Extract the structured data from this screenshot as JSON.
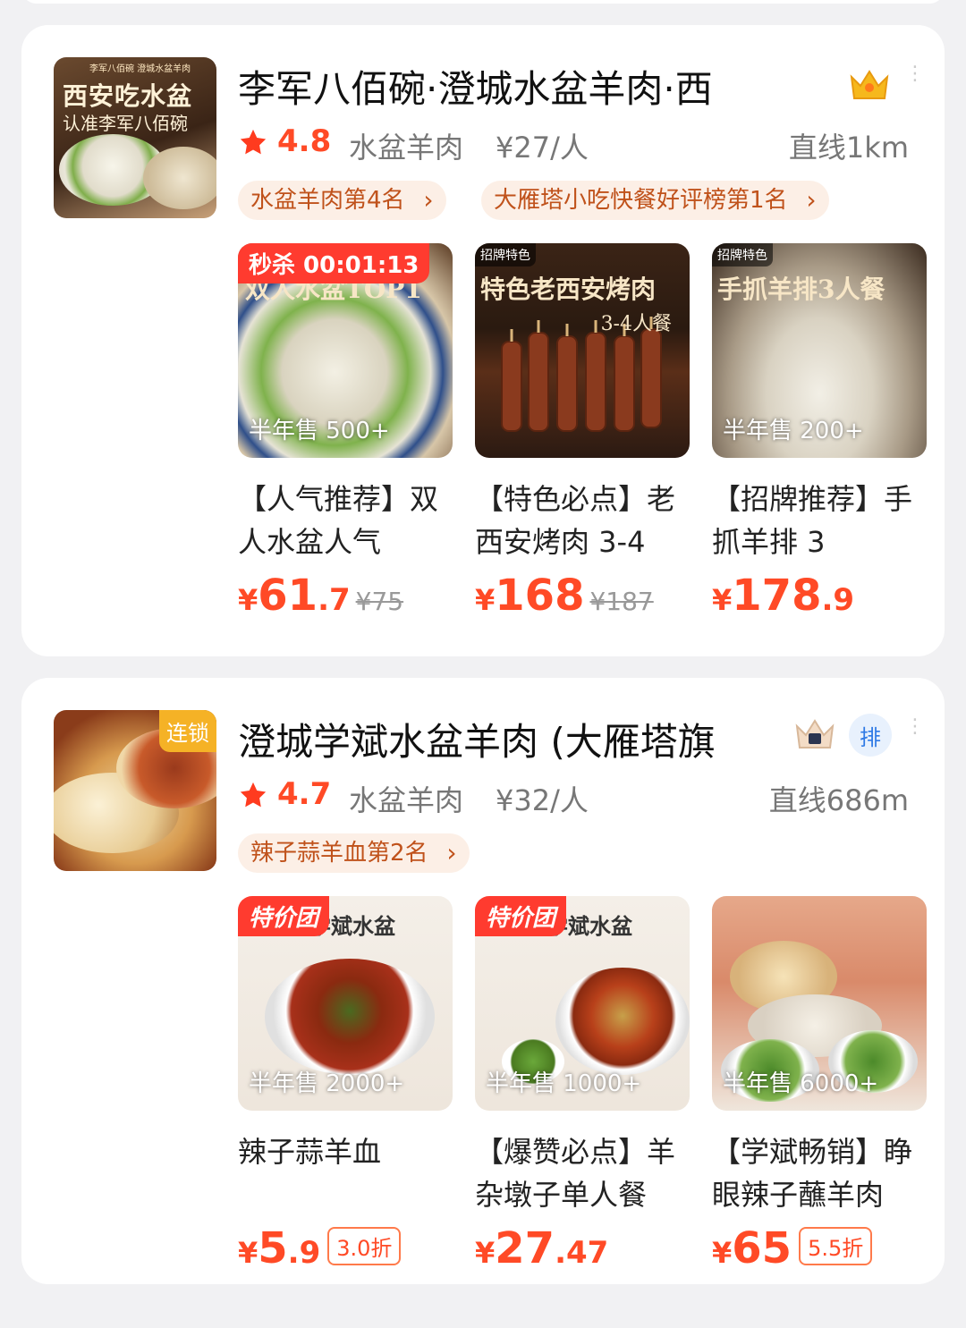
{
  "shops": [
    {
      "name": "李军八佰碗·澄城水盆羊肉·西",
      "thumb_text_top": "李军八佰碗 澄城水盆羊肉",
      "thumb_text_1": "西安吃水盆",
      "thumb_text_2": "认准李军八佰碗",
      "rating": "4.8",
      "category": "水盆羊肉",
      "price": "¥27/人",
      "distance": "直线1km",
      "tags": [
        "水盆羊肉第4名",
        "大雁塔小吃快餐好评榜第1名"
      ],
      "items": [
        {
          "badge": "秒杀 00:01:13",
          "img_text": "双人水盆TOP1",
          "sales": "半年售 500+",
          "name": "【人气推荐】双人水盆人气",
          "yen": "¥",
          "price_int": "61",
          "price_dec": ".7",
          "orig": "¥75"
        },
        {
          "badge": "招牌特色",
          "img_text": "特色老西安烤肉",
          "img_sub": "3-4人餐",
          "sales": "",
          "name": "【特色必点】老西安烤肉 3-4",
          "yen": "¥",
          "price_int": "168",
          "price_dec": "",
          "orig": "¥187"
        },
        {
          "badge": "招牌特色",
          "img_text": "手抓羊排3人餐",
          "sales": "半年售 200+",
          "name": "【招牌推荐】手抓羊排 3",
          "yen": "¥",
          "price_int": "178",
          "price_dec": ".9",
          "orig": ""
        }
      ]
    },
    {
      "name": "澄城学斌水盆羊肉 (大雁塔旗",
      "chain_badge": "连锁",
      "rank_badge": "排",
      "rating": "4.7",
      "category": "水盆羊肉",
      "price": "¥32/人",
      "distance": "直线686m",
      "tags": [
        "辣子蒜羊血第2名"
      ],
      "items": [
        {
          "badge": "特价团",
          "brand": "学斌水盆",
          "sales": "半年售 2000+",
          "name": "辣子蒜羊血",
          "yen": "¥",
          "price_int": "5",
          "price_dec": ".9",
          "discount": "3.0折"
        },
        {
          "badge": "特价团",
          "brand": "学斌水盆",
          "sales": "半年售 1000+",
          "name": "【爆赞必点】羊杂墩子单人餐",
          "yen": "¥",
          "price_int": "27",
          "price_dec": ".47",
          "discount": ""
        },
        {
          "badge": "",
          "sales": "半年售 6000+",
          "name": "【学斌畅销】睁眼辣子蘸羊肉",
          "yen": "¥",
          "price_int": "65",
          "price_dec": "",
          "discount": "5.5折"
        }
      ]
    }
  ],
  "colors": {
    "accent": "#ff4a26",
    "tag_bg": "#fcefe6",
    "tag_text": "#c0521b",
    "rank_blue": "#2f7ae5"
  }
}
